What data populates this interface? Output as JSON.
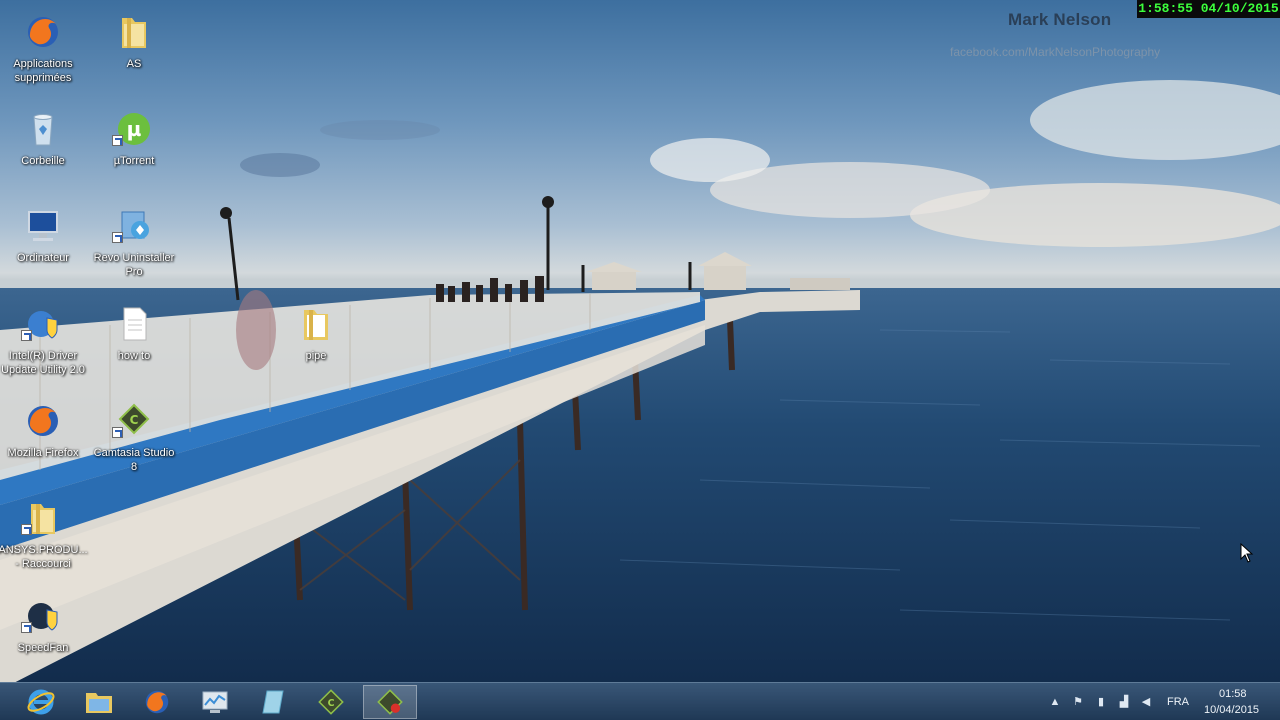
{
  "overlay": {
    "photographer": "Mark Nelson",
    "photographer_url": "facebook.com/MarkNelsonPhotography",
    "recording_clock": "1:58:55  04/10/2015"
  },
  "desktop_icons": [
    {
      "label": "Applications\nsupprimées",
      "icon": "firefox-icon"
    },
    {
      "label": "AS",
      "icon": "folder-icon"
    },
    {
      "label": "Corbeille",
      "icon": "recycle-bin-icon"
    },
    {
      "label": "µTorrent",
      "icon": "utorrent-icon"
    },
    {
      "label": "Ordinateur",
      "icon": "computer-icon"
    },
    {
      "label": "Revo Uninstaller\nPro",
      "icon": "revo-uninstaller-icon"
    },
    {
      "label": "Intel(R) Driver\nUpdate Utility 2.0",
      "icon": "intel-driver-icon"
    },
    {
      "label": "how to",
      "icon": "text-document-icon"
    },
    {
      "label": "pipe",
      "icon": "folder-icon"
    },
    {
      "label": "Mozilla Firefox",
      "icon": "firefox-icon"
    },
    {
      "label": "Camtasia Studio\n8",
      "icon": "camtasia-icon"
    },
    {
      "label": "ANSYS.PRODU...\n- Raccourci",
      "icon": "folder-shortcut-icon"
    },
    {
      "label": "SpeedFan",
      "icon": "speedfan-icon"
    }
  ],
  "taskbar": {
    "pinned": [
      {
        "name": "internet-explorer",
        "icon": "internet-explorer-icon",
        "active": false
      },
      {
        "name": "file-explorer",
        "icon": "file-explorer-icon",
        "active": false
      },
      {
        "name": "firefox",
        "icon": "firefox-icon",
        "active": false
      },
      {
        "name": "performance-monitor",
        "icon": "performance-monitor-icon",
        "active": false
      },
      {
        "name": "notepad",
        "icon": "notepad-icon",
        "active": false
      },
      {
        "name": "camtasia-studio",
        "icon": "camtasia-icon",
        "active": false
      },
      {
        "name": "camtasia-recorder",
        "icon": "camtasia-recorder-icon",
        "active": true
      }
    ],
    "tray": {
      "language": "FRA",
      "time": "01:58",
      "date": "10/04/2015"
    }
  },
  "colors": {
    "taskbar": "#1f3d5e",
    "sea": "#1e3f66",
    "pier_blue": "#2f78c2",
    "clock_green": "#3cff3c"
  }
}
